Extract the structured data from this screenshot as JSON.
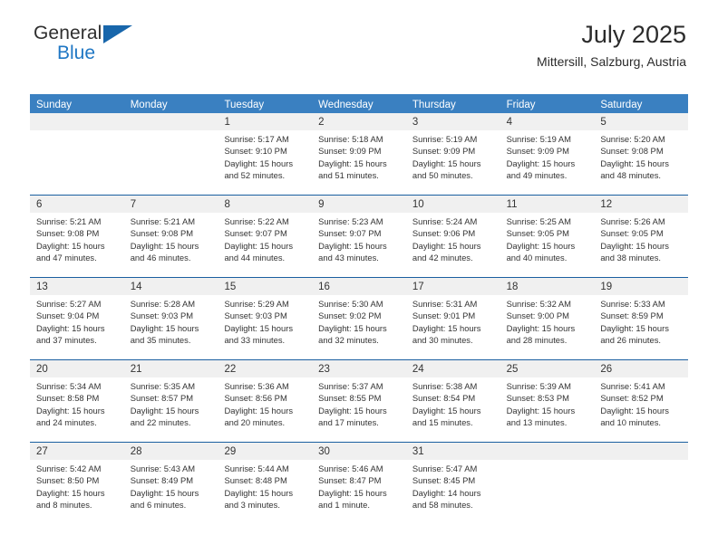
{
  "brand": {
    "name_top": "General",
    "name_bottom": "Blue",
    "triangle_color": "#1866ab",
    "blue_text_color": "#1f77c4"
  },
  "header": {
    "title": "July 2025",
    "subtitle": "Mittersill, Salzburg, Austria"
  },
  "theme": {
    "header_bg": "#3a80c1",
    "week_rule": "#1a5fa0",
    "daynum_band": "#f0f0f0",
    "text": "#333333"
  },
  "weekdays": [
    "Sunday",
    "Monday",
    "Tuesday",
    "Wednesday",
    "Thursday",
    "Friday",
    "Saturday"
  ],
  "weeks": [
    [
      {
        "day": "",
        "sunrise": "",
        "sunset": "",
        "daylight1": "",
        "daylight2": ""
      },
      {
        "day": "",
        "sunrise": "",
        "sunset": "",
        "daylight1": "",
        "daylight2": ""
      },
      {
        "day": "1",
        "sunrise": "Sunrise: 5:17 AM",
        "sunset": "Sunset: 9:10 PM",
        "daylight1": "Daylight: 15 hours",
        "daylight2": "and 52 minutes."
      },
      {
        "day": "2",
        "sunrise": "Sunrise: 5:18 AM",
        "sunset": "Sunset: 9:09 PM",
        "daylight1": "Daylight: 15 hours",
        "daylight2": "and 51 minutes."
      },
      {
        "day": "3",
        "sunrise": "Sunrise: 5:19 AM",
        "sunset": "Sunset: 9:09 PM",
        "daylight1": "Daylight: 15 hours",
        "daylight2": "and 50 minutes."
      },
      {
        "day": "4",
        "sunrise": "Sunrise: 5:19 AM",
        "sunset": "Sunset: 9:09 PM",
        "daylight1": "Daylight: 15 hours",
        "daylight2": "and 49 minutes."
      },
      {
        "day": "5",
        "sunrise": "Sunrise: 5:20 AM",
        "sunset": "Sunset: 9:08 PM",
        "daylight1": "Daylight: 15 hours",
        "daylight2": "and 48 minutes."
      }
    ],
    [
      {
        "day": "6",
        "sunrise": "Sunrise: 5:21 AM",
        "sunset": "Sunset: 9:08 PM",
        "daylight1": "Daylight: 15 hours",
        "daylight2": "and 47 minutes."
      },
      {
        "day": "7",
        "sunrise": "Sunrise: 5:21 AM",
        "sunset": "Sunset: 9:08 PM",
        "daylight1": "Daylight: 15 hours",
        "daylight2": "and 46 minutes."
      },
      {
        "day": "8",
        "sunrise": "Sunrise: 5:22 AM",
        "sunset": "Sunset: 9:07 PM",
        "daylight1": "Daylight: 15 hours",
        "daylight2": "and 44 minutes."
      },
      {
        "day": "9",
        "sunrise": "Sunrise: 5:23 AM",
        "sunset": "Sunset: 9:07 PM",
        "daylight1": "Daylight: 15 hours",
        "daylight2": "and 43 minutes."
      },
      {
        "day": "10",
        "sunrise": "Sunrise: 5:24 AM",
        "sunset": "Sunset: 9:06 PM",
        "daylight1": "Daylight: 15 hours",
        "daylight2": "and 42 minutes."
      },
      {
        "day": "11",
        "sunrise": "Sunrise: 5:25 AM",
        "sunset": "Sunset: 9:05 PM",
        "daylight1": "Daylight: 15 hours",
        "daylight2": "and 40 minutes."
      },
      {
        "day": "12",
        "sunrise": "Sunrise: 5:26 AM",
        "sunset": "Sunset: 9:05 PM",
        "daylight1": "Daylight: 15 hours",
        "daylight2": "and 38 minutes."
      }
    ],
    [
      {
        "day": "13",
        "sunrise": "Sunrise: 5:27 AM",
        "sunset": "Sunset: 9:04 PM",
        "daylight1": "Daylight: 15 hours",
        "daylight2": "and 37 minutes."
      },
      {
        "day": "14",
        "sunrise": "Sunrise: 5:28 AM",
        "sunset": "Sunset: 9:03 PM",
        "daylight1": "Daylight: 15 hours",
        "daylight2": "and 35 minutes."
      },
      {
        "day": "15",
        "sunrise": "Sunrise: 5:29 AM",
        "sunset": "Sunset: 9:03 PM",
        "daylight1": "Daylight: 15 hours",
        "daylight2": "and 33 minutes."
      },
      {
        "day": "16",
        "sunrise": "Sunrise: 5:30 AM",
        "sunset": "Sunset: 9:02 PM",
        "daylight1": "Daylight: 15 hours",
        "daylight2": "and 32 minutes."
      },
      {
        "day": "17",
        "sunrise": "Sunrise: 5:31 AM",
        "sunset": "Sunset: 9:01 PM",
        "daylight1": "Daylight: 15 hours",
        "daylight2": "and 30 minutes."
      },
      {
        "day": "18",
        "sunrise": "Sunrise: 5:32 AM",
        "sunset": "Sunset: 9:00 PM",
        "daylight1": "Daylight: 15 hours",
        "daylight2": "and 28 minutes."
      },
      {
        "day": "19",
        "sunrise": "Sunrise: 5:33 AM",
        "sunset": "Sunset: 8:59 PM",
        "daylight1": "Daylight: 15 hours",
        "daylight2": "and 26 minutes."
      }
    ],
    [
      {
        "day": "20",
        "sunrise": "Sunrise: 5:34 AM",
        "sunset": "Sunset: 8:58 PM",
        "daylight1": "Daylight: 15 hours",
        "daylight2": "and 24 minutes."
      },
      {
        "day": "21",
        "sunrise": "Sunrise: 5:35 AM",
        "sunset": "Sunset: 8:57 PM",
        "daylight1": "Daylight: 15 hours",
        "daylight2": "and 22 minutes."
      },
      {
        "day": "22",
        "sunrise": "Sunrise: 5:36 AM",
        "sunset": "Sunset: 8:56 PM",
        "daylight1": "Daylight: 15 hours",
        "daylight2": "and 20 minutes."
      },
      {
        "day": "23",
        "sunrise": "Sunrise: 5:37 AM",
        "sunset": "Sunset: 8:55 PM",
        "daylight1": "Daylight: 15 hours",
        "daylight2": "and 17 minutes."
      },
      {
        "day": "24",
        "sunrise": "Sunrise: 5:38 AM",
        "sunset": "Sunset: 8:54 PM",
        "daylight1": "Daylight: 15 hours",
        "daylight2": "and 15 minutes."
      },
      {
        "day": "25",
        "sunrise": "Sunrise: 5:39 AM",
        "sunset": "Sunset: 8:53 PM",
        "daylight1": "Daylight: 15 hours",
        "daylight2": "and 13 minutes."
      },
      {
        "day": "26",
        "sunrise": "Sunrise: 5:41 AM",
        "sunset": "Sunset: 8:52 PM",
        "daylight1": "Daylight: 15 hours",
        "daylight2": "and 10 minutes."
      }
    ],
    [
      {
        "day": "27",
        "sunrise": "Sunrise: 5:42 AM",
        "sunset": "Sunset: 8:50 PM",
        "daylight1": "Daylight: 15 hours",
        "daylight2": "and 8 minutes."
      },
      {
        "day": "28",
        "sunrise": "Sunrise: 5:43 AM",
        "sunset": "Sunset: 8:49 PM",
        "daylight1": "Daylight: 15 hours",
        "daylight2": "and 6 minutes."
      },
      {
        "day": "29",
        "sunrise": "Sunrise: 5:44 AM",
        "sunset": "Sunset: 8:48 PM",
        "daylight1": "Daylight: 15 hours",
        "daylight2": "and 3 minutes."
      },
      {
        "day": "30",
        "sunrise": "Sunrise: 5:46 AM",
        "sunset": "Sunset: 8:47 PM",
        "daylight1": "Daylight: 15 hours",
        "daylight2": "and 1 minute."
      },
      {
        "day": "31",
        "sunrise": "Sunrise: 5:47 AM",
        "sunset": "Sunset: 8:45 PM",
        "daylight1": "Daylight: 14 hours",
        "daylight2": "and 58 minutes."
      },
      {
        "day": "",
        "sunrise": "",
        "sunset": "",
        "daylight1": "",
        "daylight2": ""
      },
      {
        "day": "",
        "sunrise": "",
        "sunset": "",
        "daylight1": "",
        "daylight2": ""
      }
    ]
  ]
}
